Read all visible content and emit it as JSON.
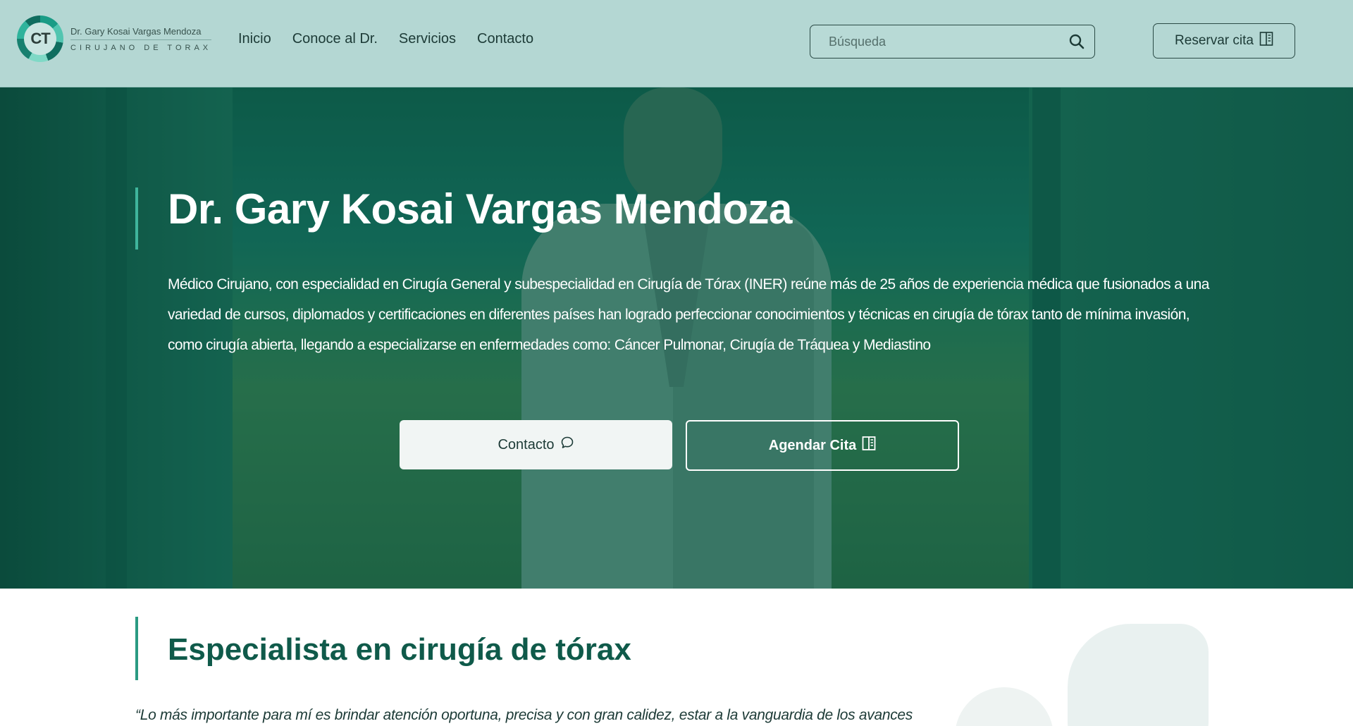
{
  "header": {
    "logo_initials": "CT",
    "logo_name": "Dr. Gary Kosai Vargas Mendoza",
    "logo_subtitle": "CIRUJANO DE TORAX",
    "nav": [
      {
        "label": "Inicio"
      },
      {
        "label": "Conoce al Dr."
      },
      {
        "label": "Servicios"
      },
      {
        "label": "Contacto"
      }
    ],
    "search_placeholder": "Búsqueda",
    "reserve_label": "Reservar cita"
  },
  "hero": {
    "title": "Dr. Gary Kosai Vargas Mendoza",
    "description": "Médico Cirujano, con especialidad en Cirugía General y subespecialidad en Cirugía de Tórax (INER) reúne más de 25 años de experiencia médica que fusionados a una variedad de cursos, diplomados y certificaciones en diferentes países han logrado perfeccionar conocimientos y técnicas en cirugía de tórax tanto de mínima invasión, como cirugía abierta, llegando a especializarse en enfermedades como: Cáncer Pulmonar, Cirugía de Tráquea y Mediastino",
    "contact_button": "Contacto",
    "appointment_button": "Agendar Cita"
  },
  "section": {
    "title": "Especialista en cirugía de tórax",
    "quote": "“Lo más importante para mí es brindar atención oportuna, precisa y con gran calidez, estar a la vanguardia de los avances"
  },
  "colors": {
    "header_bg": "#b4d7d3",
    "accent": "#3fb59c",
    "dark_text": "#1c3a36",
    "section_title": "#0f5a4a"
  },
  "icons": {
    "search": "search-icon",
    "calendar": "calendar-icon",
    "chat": "chat-bubble-icon"
  }
}
